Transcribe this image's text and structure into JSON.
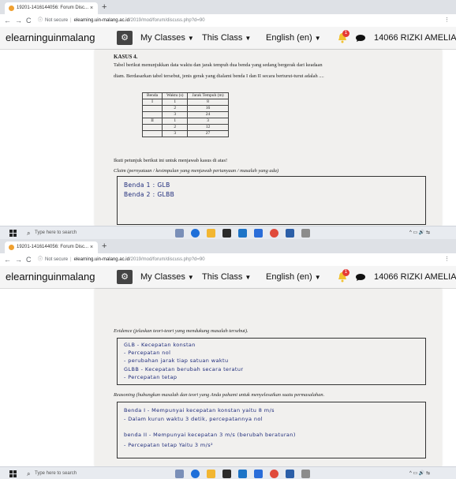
{
  "browser": {
    "tab_title": "19201-1416144056: Forum Disc...",
    "tab_close": "×",
    "new_tab": "+",
    "nav_back": "←",
    "nav_forward": "→",
    "nav_reload": "C",
    "security_label": "Not secure",
    "url_host": "elearning.uin-malang.ac.id",
    "url_path": "/2019/mod/forum/discuss.php?d=90"
  },
  "navbar": {
    "brand": "elearninguinmalang",
    "menu_classes": "My Classes",
    "menu_this_class": "This Class",
    "menu_language": "English (en)",
    "notification_count": "1",
    "username": "14066 RIZKI AMELIA,M.Pd",
    "colors": {
      "background": "#f5f5f5",
      "notification": "#e53935",
      "gear_button": "#444444"
    },
    "icons": [
      "gear-icon",
      "caret-down-icon",
      "bell-icon",
      "chat-icon"
    ]
  },
  "document_1": {
    "title": "KASUS 4.",
    "prompt_line1": "Tabel berikut menunjukkan data waktu dan jarak tempuh dua benda yang sedang bergerak dari keadaan",
    "prompt_line2": "diam. Berdasarkan tabel tersebut, jenis gerak yang dialami benda I dan II secara berturut-turut adalah ....",
    "table": {
      "headers": [
        "Benda",
        "Waktu (s)",
        "Jarak Tempuh (m)"
      ],
      "rows": [
        [
          "I",
          "1",
          "8"
        ],
        [
          "",
          "2",
          "16"
        ],
        [
          "",
          "3",
          "24"
        ],
        [
          "II",
          "1",
          "3"
        ],
        [
          "",
          "2",
          "12"
        ],
        [
          "",
          "3",
          "27"
        ]
      ]
    },
    "instruction": "Ikuti petunjuk berikut ini untuk menjawab kasus di atas!",
    "claim_label": "Claim (pernyataan / kesimpulan yang menjawab pertanyaan / masalah yang ada)",
    "claim_answer_line1": "Benda 1 : GLB",
    "claim_answer_line2": "Benda 2 : GLBB"
  },
  "document_2": {
    "evidence_label": "Evidence (jelaskan teori-teori yang mendukung masalah tersebut).",
    "evidence_lines": [
      "GLB   - Kecepatan konstan",
      "         - Percepatan nol",
      "         - perubahan jarak tiap satuan waktu",
      "GLBB  - Kecepatan berubah secara teratur",
      "         - Percepatan tetap"
    ],
    "reasoning_label": "Reasoning (hubungkan masalah dan teori yang Anda pahami untuk menyelesaikan suatu permasalahan.",
    "reasoning_lines": [
      "Benda I  - Mempunyai kecepatan konstan yaitu 8 m/s",
      "              - Dalam kurun waktu 3 detik, percepatannya nol",
      "benda II  - Mempunyai kecepatan 3 m/s (berubah beraturan)",
      "              - Percepatan tetap Yaitu 3 m/s²"
    ]
  },
  "taskbar": {
    "search_placeholder": "Type here to search",
    "tray_text": "^ ▭ 🔊 ⇆"
  }
}
